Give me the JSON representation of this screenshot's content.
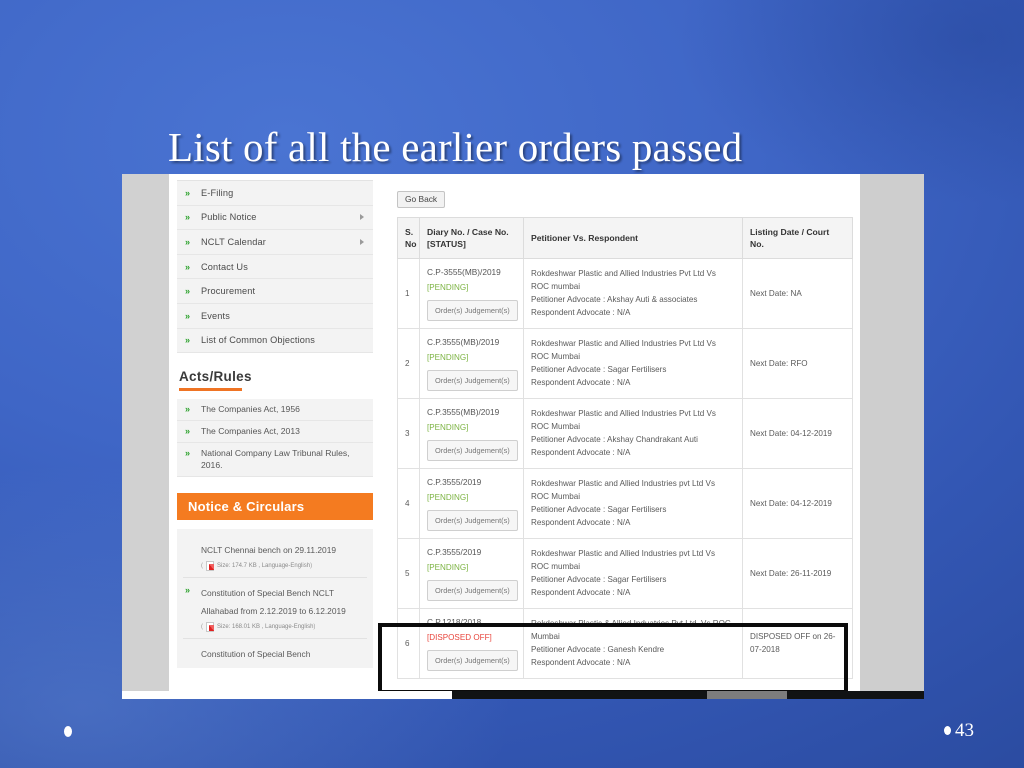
{
  "slide": {
    "title": "List of all the earlier orders passed",
    "page_number": "43",
    "background_color": "#3a63c0"
  },
  "sidebar": {
    "nav_items": [
      {
        "label": "E-Filing",
        "has_submenu": false
      },
      {
        "label": "Public Notice",
        "has_submenu": true
      },
      {
        "label": "NCLT Calendar",
        "has_submenu": true
      },
      {
        "label": "Contact Us",
        "has_submenu": false
      },
      {
        "label": "Procurement",
        "has_submenu": false
      },
      {
        "label": "Events",
        "has_submenu": false
      },
      {
        "label": "List of Common Objections",
        "has_submenu": false
      }
    ],
    "acts_rules": {
      "heading": "Acts/Rules",
      "accent_color": "#ef7424",
      "items": [
        {
          "label": "The Companies Act, 1956"
        },
        {
          "label": "The Companies Act, 2013"
        },
        {
          "label": "National Company Law Tribunal Rules, 2016."
        }
      ]
    },
    "notice_circulars": {
      "heading": "Notice & Circulars",
      "bar_color": "#f47b20",
      "items": [
        {
          "title": "NCLT Chennai bench on 29.11.2019",
          "meta": "Size: 174.7 KB , Language-English",
          "has_chevron": false
        },
        {
          "title": "Constitution of Special Bench NCLT Allahabad from 2.12.2019 to 6.12.2019",
          "meta": "Size: 168.01 KB , Language-English",
          "has_chevron": true
        },
        {
          "title": "Constitution of Special Bench",
          "meta": "",
          "has_chevron": false
        }
      ]
    }
  },
  "main": {
    "go_back_label": "Go Back",
    "table": {
      "headers": [
        "S. No",
        "Diary No. / Case No. [STATUS]",
        "Petitioner Vs. Respondent",
        "Listing Date / Court No."
      ],
      "orders_button_label": "Order(s) Judgement(s)",
      "status_pending_color": "#7cb342",
      "status_disposed_color": "#e8453c",
      "rows": [
        {
          "sno": "1",
          "case_no": "C.P-3555(MB)/2019",
          "status": "[PENDING]",
          "status_type": "pending",
          "party_lines": [
            "Rokdeshwar Plastic and Allied Industries Pvt Ltd Vs",
            "ROC mumbai",
            "Petitioner Advocate : Akshay Auti & associates",
            "Respondent Advocate : N/A"
          ],
          "listing": "Next Date: NA",
          "highlighted": false
        },
        {
          "sno": "2",
          "case_no": "C.P.3555(MB)/2019",
          "status": "[PENDING]",
          "status_type": "pending",
          "party_lines": [
            "Rokdeshwar Plastic and Allied Industries Pvt Ltd Vs",
            "ROC Mumbai",
            "Petitioner Advocate : Sagar Fertilisers",
            "Respondent Advocate : N/A"
          ],
          "listing": "Next Date: RFO",
          "highlighted": false
        },
        {
          "sno": "3",
          "case_no": "C.P.3555(MB)/2019",
          "status": "[PENDING]",
          "status_type": "pending",
          "party_lines": [
            "Rokdeshwar Plastic and Allied Industries Pvt Ltd Vs",
            "ROC Mumbai",
            "Petitioner Advocate : Akshay Chandrakant Auti",
            "Respondent Advocate : N/A"
          ],
          "listing": "Next Date: 04-12-2019",
          "highlighted": false
        },
        {
          "sno": "4",
          "case_no": "C.P.3555/2019",
          "status": "[PENDING]",
          "status_type": "pending",
          "party_lines": [
            "Rokdeshwar Plastic and Allied Industries pvt Ltd Vs",
            "ROC Mumbai",
            "Petitioner Advocate : Sagar Fertilisers",
            "Respondent Advocate : N/A"
          ],
          "listing": "Next Date: 04-12-2019",
          "highlighted": false
        },
        {
          "sno": "5",
          "case_no": "C.P.3555/2019",
          "status": "[PENDING]",
          "status_type": "pending",
          "party_lines": [
            "Rokdeshwar Plastic and Allied Industries pvt Ltd Vs",
            "ROC mumbai",
            "Petitioner Advocate : Sagar Fertilisers",
            "Respondent Advocate : N/A"
          ],
          "listing": "Next Date: 26-11-2019",
          "highlighted": false
        },
        {
          "sno": "6",
          "case_no": "C.P.1218/2018",
          "status": "[DISPOSED OFF]",
          "status_type": "disposed",
          "party_lines": [
            "Rokdeshwar Plastic & Allied Induatries Pvt.Ltd. Vs ROC,",
            "Mumbai",
            "Petitioner Advocate : Ganesh Kendre",
            "Respondent Advocate : N/A"
          ],
          "listing": "DISPOSED OFF on 26-07-2018",
          "highlighted": true
        }
      ]
    }
  }
}
